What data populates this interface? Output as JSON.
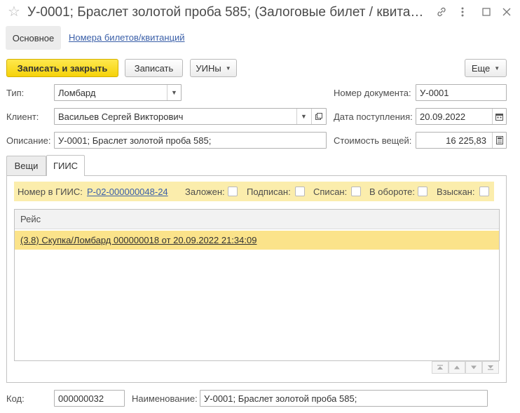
{
  "window": {
    "title": "У-0001; Браслет золотой проба 585; (Залоговые билет / квита…",
    "icons": [
      "star-icon",
      "link-icon",
      "more-icon",
      "maximize-icon",
      "close-icon"
    ]
  },
  "nav": {
    "main_label": "Основное",
    "tickets_label": "Номера билетов/квитанций"
  },
  "toolbar": {
    "save_close_label": "Записать и закрыть",
    "save_label": "Записать",
    "uins_label": "УИНы",
    "more_label": "Еще"
  },
  "form": {
    "type_label": "Тип:",
    "type_value": "Ломбард",
    "client_label": "Клиент:",
    "client_value": "Васильев Сергей Викторович",
    "description_label": "Описание:",
    "description_value": "У-0001; Браслет золотой проба 585;",
    "docnum_label": "Номер документа:",
    "docnum_value": "У-0001",
    "date_label": "Дата поступления:",
    "date_value": "20.09.2022",
    "cost_label": "Стоимость вещей:",
    "cost_value": "16 225,83"
  },
  "tabs": [
    {
      "label": "Вещи",
      "active": false
    },
    {
      "label": "ГИИС",
      "active": true
    }
  ],
  "giis": {
    "number_label": "Номер в ГИИС:",
    "number_value": "Р-02-000000048-24",
    "flags": [
      {
        "label": "Заложен:",
        "checked": false
      },
      {
        "label": "Подписан:",
        "checked": false
      },
      {
        "label": "Списан:",
        "checked": false
      },
      {
        "label": "В обороте:",
        "checked": false
      },
      {
        "label": "Взыскан:",
        "checked": false
      }
    ]
  },
  "table": {
    "column": "Рейс",
    "rows": [
      "(3.8) Скупка/Ломбард 000000018 от 20.09.2022 21:34:09"
    ]
  },
  "footer": {
    "code_label": "Код:",
    "code_value": "000000032",
    "name_label": "Наименование:",
    "name_value": "У-0001; Браслет золотой проба 585;"
  }
}
